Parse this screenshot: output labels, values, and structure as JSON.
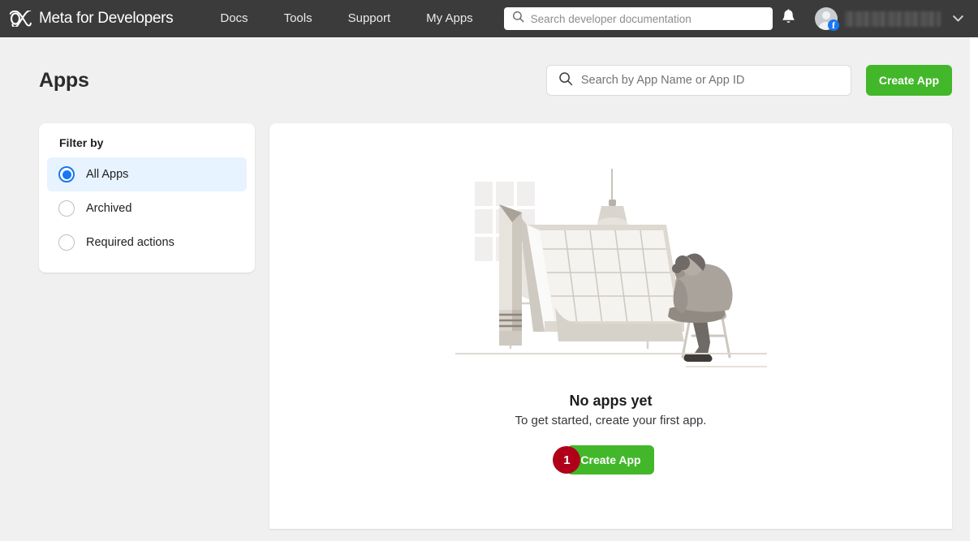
{
  "topnav": {
    "brand": "Meta for Developers",
    "brand_logo_icon": "meta-infinity-logo",
    "links": [
      {
        "label": "Docs"
      },
      {
        "label": "Tools"
      },
      {
        "label": "Support"
      },
      {
        "label": "My Apps"
      }
    ],
    "doc_search": {
      "placeholder": "Search developer documentation",
      "value": "",
      "icon": "search-icon"
    },
    "notifications_icon": "bell-icon",
    "profile": {
      "avatar_icon": "default-user-avatar",
      "badge_icon": "facebook-badge",
      "username": "",
      "username_redacted": true,
      "caret_icon": "chevron-down-icon"
    }
  },
  "page": {
    "title": "Apps",
    "app_search": {
      "placeholder": "Search by App Name or App ID",
      "value": "",
      "icon": "search-icon"
    },
    "create_app_label": "Create App"
  },
  "filter_panel": {
    "title": "Filter by",
    "options": [
      {
        "label": "All Apps",
        "selected": true
      },
      {
        "label": "Archived",
        "selected": false
      },
      {
        "label": "Required actions",
        "selected": false
      }
    ]
  },
  "empty_state": {
    "illustration_icon": "person-at-drafting-table-illustration",
    "title": "No apps yet",
    "subtitle": "To get started, create your first app.",
    "cta_label": "Create App",
    "marker_number": "1"
  },
  "colors": {
    "nav_bg": "#3b3b3b",
    "page_bg": "#f0f0f0",
    "accent_green": "#42b72a",
    "accent_blue": "#1877f2",
    "selected_row_bg": "#e7f3ff",
    "marker_red": "#b00019"
  }
}
